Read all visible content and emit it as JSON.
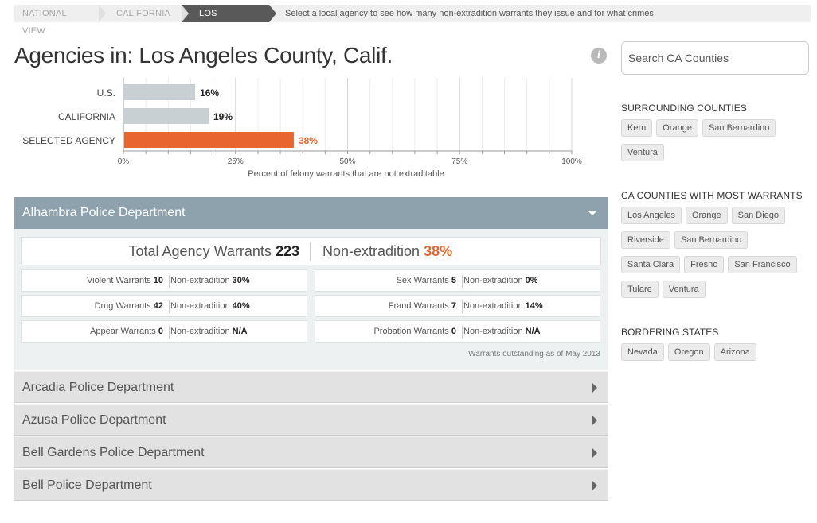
{
  "breadcrumb": {
    "items": [
      "National View",
      "California",
      "Los Angeles"
    ],
    "hint": "Select a local agency to see how many non-extradition warrants they issue and for what crimes"
  },
  "title": "Agencies in: Los Angeles County, Calif.",
  "info_icon_glyph": "i",
  "chart_data": {
    "type": "bar",
    "orientation": "horizontal",
    "categories": [
      "U.S.",
      "CALIFORNIA",
      "SELECTED AGENCY"
    ],
    "values": [
      16,
      19,
      38
    ],
    "value_labels": [
      "16%",
      "19%",
      "38%"
    ],
    "xlabel": "Percent of felony warrants that are not extraditable",
    "xlim": [
      0,
      100
    ],
    "xticks": [
      "0%",
      "25%",
      "50%",
      "75%",
      "100%"
    ],
    "colors": [
      "#c9d0d4",
      "#c9d0d4",
      "#e8662e"
    ],
    "grid": true
  },
  "open_agency": {
    "name": "Alhambra Police Department",
    "total_label": "Total Agency Warrants",
    "total_value": "223",
    "nonext_label": "Non-extradition",
    "nonext_value": "38%",
    "rows": [
      {
        "label": "Violent Warrants",
        "count": "10",
        "nx_label": "Non-extradition",
        "nx_value": "30%"
      },
      {
        "label": "Sex Warrants",
        "count": "5",
        "nx_label": "Non-extradition",
        "nx_value": "0%"
      },
      {
        "label": "Drug Warrants",
        "count": "42",
        "nx_label": "Non-extradition",
        "nx_value": "40%"
      },
      {
        "label": "Fraud Warrants",
        "count": "7",
        "nx_label": "Non-extradition",
        "nx_value": "14%"
      },
      {
        "label": "Appear Warrants",
        "count": "0",
        "nx_label": "Non-extradition",
        "nx_value": "N/A"
      },
      {
        "label": "Probation Warrants",
        "count": "0",
        "nx_label": "Non-extradition",
        "nx_value": "N/A"
      }
    ],
    "as_of": "Warrants outstanding as of May 2013"
  },
  "agencies": [
    "Arcadia Police Department",
    "Azusa Police Department",
    "Bell Gardens Police Department",
    "Bell Police Department"
  ],
  "sidebar": {
    "search_placeholder": "Search CA Counties",
    "surrounding_title": "Surrounding Counties",
    "surrounding": [
      "Kern",
      "Orange",
      "San Bernardino",
      "Ventura"
    ],
    "most_title": "CA Counties with Most Warrants",
    "most": [
      "Los Angeles",
      "Orange",
      "San Diego",
      "Riverside",
      "San Bernardino",
      "Santa Clara",
      "Fresno",
      "San Francisco",
      "Tulare",
      "Ventura"
    ],
    "bordering_title": "Bordering States",
    "bordering": [
      "Nevada",
      "Oregon",
      "Arizona"
    ]
  }
}
